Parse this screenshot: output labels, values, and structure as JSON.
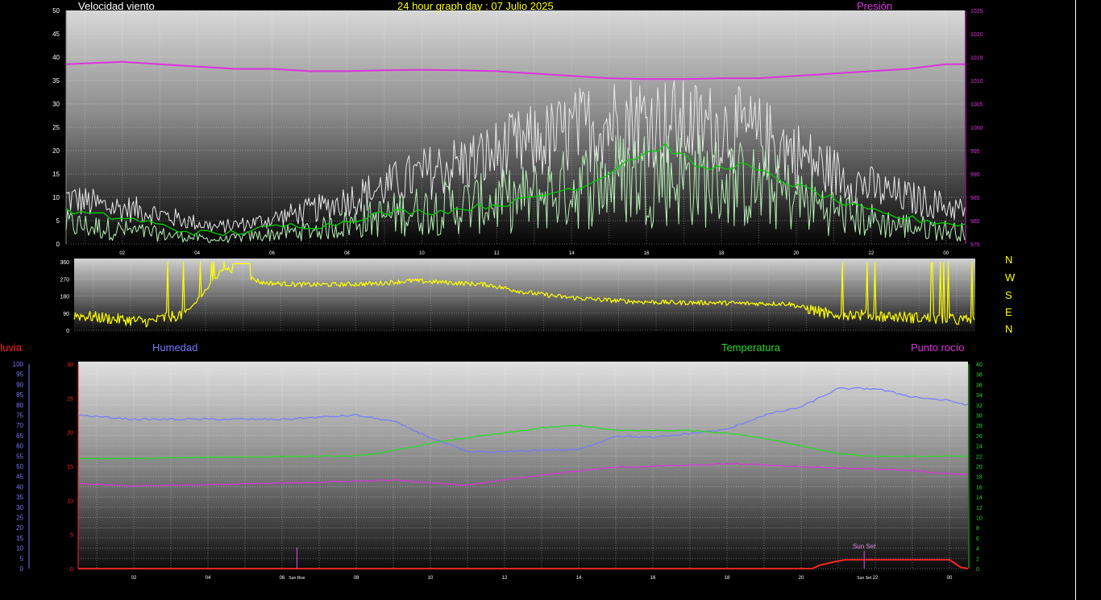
{
  "header": {
    "wind_title": "Velocidad viento",
    "graph_title": "24 hour graph day : 07 Julio 2025",
    "pressure_title": "Presión"
  },
  "lower_titles": {
    "rain": "Lluvia",
    "humidity": "Humedad",
    "temperature": "Temperatura",
    "dewpoint": "Punto rocío"
  },
  "compass": [
    "N",
    "W",
    "S",
    "E",
    "N"
  ],
  "markers": {
    "sunrise": "Sun Rise",
    "sunset": "Sun Set",
    "sunset_small": "Sun Set"
  },
  "colors": {
    "wind_gust": "#e8e8e8",
    "wind_speed": "#b8f0b8",
    "wind_avg": "#00d000",
    "pressure": "#dd33dd",
    "direction": "#ffff00",
    "humidity": "#7777ff",
    "temperature": "#22dd22",
    "dewpoint": "#dd33dd",
    "rain": "#ff2222"
  },
  "chart_data": [
    {
      "type": "line",
      "name_panel": "wind_pressure",
      "x_ticks": [
        "02",
        "04",
        "06",
        "08",
        "10",
        "12",
        "14",
        "16",
        "18",
        "20",
        "22",
        "00"
      ],
      "x_range_hours": [
        0.5,
        24.5
      ],
      "left_axis": {
        "ticks": [
          "0",
          "5",
          "10",
          "15",
          "20",
          "25",
          "30",
          "35",
          "40",
          "45",
          "50"
        ],
        "ylim": [
          0,
          50
        ]
      },
      "right_axis": {
        "ticks": [
          "975",
          "980",
          "985",
          "990",
          "995",
          "1000",
          "1005",
          "1010",
          "1015",
          "1020",
          "1025"
        ],
        "ylim": [
          975,
          1025
        ]
      },
      "series": [
        {
          "name": "Presión",
          "axis": "right",
          "x": [
            0.5,
            2,
            3,
            4,
            5,
            6,
            7,
            8,
            9,
            10,
            11,
            12,
            13,
            14,
            15,
            16,
            17,
            18,
            19,
            20,
            21,
            22,
            23,
            24,
            24.5
          ],
          "values": [
            1013.5,
            1014,
            1013.5,
            1013,
            1012.5,
            1012.5,
            1012,
            1012,
            1012.2,
            1012.3,
            1012.2,
            1012,
            1011.5,
            1011,
            1010.5,
            1010.3,
            1010.3,
            1010.5,
            1010.5,
            1011,
            1011.5,
            1012,
            1012.5,
            1013.5,
            1013.5
          ]
        },
        {
          "name": "gust",
          "axis": "left",
          "x": [
            0.5,
            1.5,
            2.5,
            3.5,
            4.5,
            5.5,
            6.5,
            7.5,
            8.5,
            9.5,
            10.5,
            11.5,
            12.5,
            13.5,
            14.5,
            15.5,
            16.5,
            17.5,
            18.5,
            19.5,
            20.5,
            21.5,
            22.5,
            23.5,
            24.5
          ],
          "values": [
            11,
            9,
            8,
            6,
            4,
            5,
            7,
            9,
            12,
            15,
            18,
            20,
            23,
            25,
            28,
            30,
            29,
            28,
            27,
            24,
            19,
            15,
            12,
            10,
            8
          ]
        },
        {
          "name": "speed",
          "axis": "left",
          "x": [
            0.5,
            1.5,
            2.5,
            3.5,
            4.5,
            5.5,
            6.5,
            7.5,
            8.5,
            9.5,
            10.5,
            11.5,
            12.5,
            13.5,
            14.5,
            15.5,
            16.5,
            17.5,
            18.5,
            19.5,
            20.5,
            21.5,
            22.5,
            23.5,
            24.5
          ],
          "values": [
            5,
            4,
            3,
            2,
            1,
            2,
            3,
            4,
            6,
            8,
            9,
            10,
            11,
            13,
            15,
            17,
            17,
            16,
            15,
            13,
            10,
            7,
            5,
            4,
            3
          ]
        },
        {
          "name": "average",
          "axis": "left",
          "x": [
            0.5,
            1.5,
            2.5,
            3.5,
            4.5,
            5.5,
            6.5,
            7.5,
            8.5,
            9.5,
            10.5,
            11.5,
            12.5,
            13.5,
            14.5,
            15.5,
            16.5,
            17.5,
            18.5,
            19.5,
            20.5,
            21.5,
            22.5,
            23.5,
            24.5
          ],
          "values": [
            7,
            6,
            5,
            3,
            2,
            3,
            4,
            4,
            6,
            7,
            7,
            8,
            9,
            11,
            13,
            18,
            21,
            16,
            17,
            14,
            11,
            8,
            6,
            5,
            4
          ]
        }
      ]
    },
    {
      "type": "line",
      "name_panel": "direction",
      "left_axis": {
        "ticks": [
          "0",
          "90",
          "180",
          "270",
          "360"
        ],
        "ylim": [
          0,
          360
        ]
      },
      "series": [
        {
          "name": "direction",
          "x": [
            0.5,
            1.5,
            2.5,
            3.5,
            4.5,
            5.5,
            6.5,
            7.5,
            8.5,
            9.5,
            10.5,
            11.5,
            12.5,
            13.5,
            14.5,
            15.5,
            16.5,
            17.5,
            18.5,
            19.5,
            20.5,
            21.5,
            22.5,
            23.5,
            24.5
          ],
          "values": [
            80,
            60,
            45,
            90,
            330,
            250,
            240,
            240,
            245,
            260,
            250,
            240,
            200,
            175,
            160,
            150,
            145,
            145,
            140,
            140,
            90,
            80,
            70,
            60,
            50
          ]
        }
      ]
    },
    {
      "type": "line",
      "name_panel": "temp_humidity",
      "x_ticks": [
        "02",
        "04",
        "06",
        "08",
        "10",
        "12",
        "14",
        "16",
        "18",
        "20",
        "22",
        "00"
      ],
      "rain_axis": {
        "ticks": [
          "0",
          "5",
          "10",
          "15",
          "20",
          "25",
          "30"
        ],
        "ylim": [
          0,
          30
        ]
      },
      "humidity_axis": {
        "ticks": [
          "0",
          "5",
          "10",
          "15",
          "20",
          "25",
          "30",
          "35",
          "40",
          "45",
          "50",
          "55",
          "60",
          "65",
          "70",
          "75",
          "80",
          "85",
          "90",
          "95",
          "100"
        ],
        "ylim": [
          0,
          100
        ]
      },
      "temperature_axis": {
        "ticks": [
          "0",
          "2",
          "4",
          "6",
          "8",
          "10",
          "12",
          "14",
          "16",
          "18",
          "20",
          "22",
          "24",
          "26",
          "28",
          "30",
          "32",
          "34",
          "36",
          "38",
          "40"
        ],
        "ylim": [
          0,
          40
        ]
      },
      "series": [
        {
          "name": "Humedad",
          "axis": "humidity",
          "x": [
            0.5,
            2,
            4,
            6,
            8,
            9,
            10,
            11,
            12,
            13,
            14,
            15,
            16,
            17,
            18,
            19,
            20,
            21,
            22,
            23,
            24,
            24.5
          ],
          "values": [
            75,
            73,
            73,
            73,
            75,
            72,
            64,
            57,
            57,
            58,
            58,
            65,
            64,
            66,
            68,
            75,
            79,
            88,
            88,
            84,
            82,
            80
          ]
        },
        {
          "name": "Temperatura",
          "axis": "temperature",
          "x": [
            0.5,
            2,
            4,
            6,
            8,
            9,
            10,
            11,
            12,
            13,
            14,
            15,
            16,
            17,
            18,
            19,
            20,
            21,
            22,
            23,
            24,
            24.5
          ],
          "values": [
            21.5,
            21.5,
            21.8,
            21.9,
            22,
            23,
            24.5,
            25.6,
            26.5,
            27.5,
            28,
            27,
            27,
            27,
            26.5,
            25.5,
            24,
            22.5,
            21.9,
            21.9,
            22,
            22
          ]
        },
        {
          "name": "Punto rocío",
          "axis": "temperature",
          "x": [
            0.5,
            2,
            4,
            6,
            8,
            9,
            10,
            11,
            12,
            13,
            14,
            15,
            16,
            17,
            18,
            19,
            20,
            21,
            22,
            23,
            24,
            24.5
          ],
          "values": [
            16.6,
            16.2,
            16.4,
            16.7,
            17.1,
            17.3,
            16.8,
            16.3,
            17.4,
            18.3,
            19.1,
            19.8,
            20,
            20.2,
            20.5,
            20.3,
            19.9,
            19.7,
            19.5,
            19.2,
            18.5,
            18.4
          ]
        },
        {
          "name": "Lluvia",
          "axis": "rain",
          "x": [
            0.5,
            20.3,
            20.5,
            20.9,
            21.2,
            24.0,
            24.3,
            24.5
          ],
          "values": [
            0,
            0,
            0.5,
            1,
            1.3,
            1.3,
            0.2,
            0
          ]
        }
      ],
      "markers": [
        {
          "label": "Sun Rise",
          "x": 6.4
        },
        {
          "label": "Sun Set",
          "x": 21.7
        }
      ]
    }
  ]
}
